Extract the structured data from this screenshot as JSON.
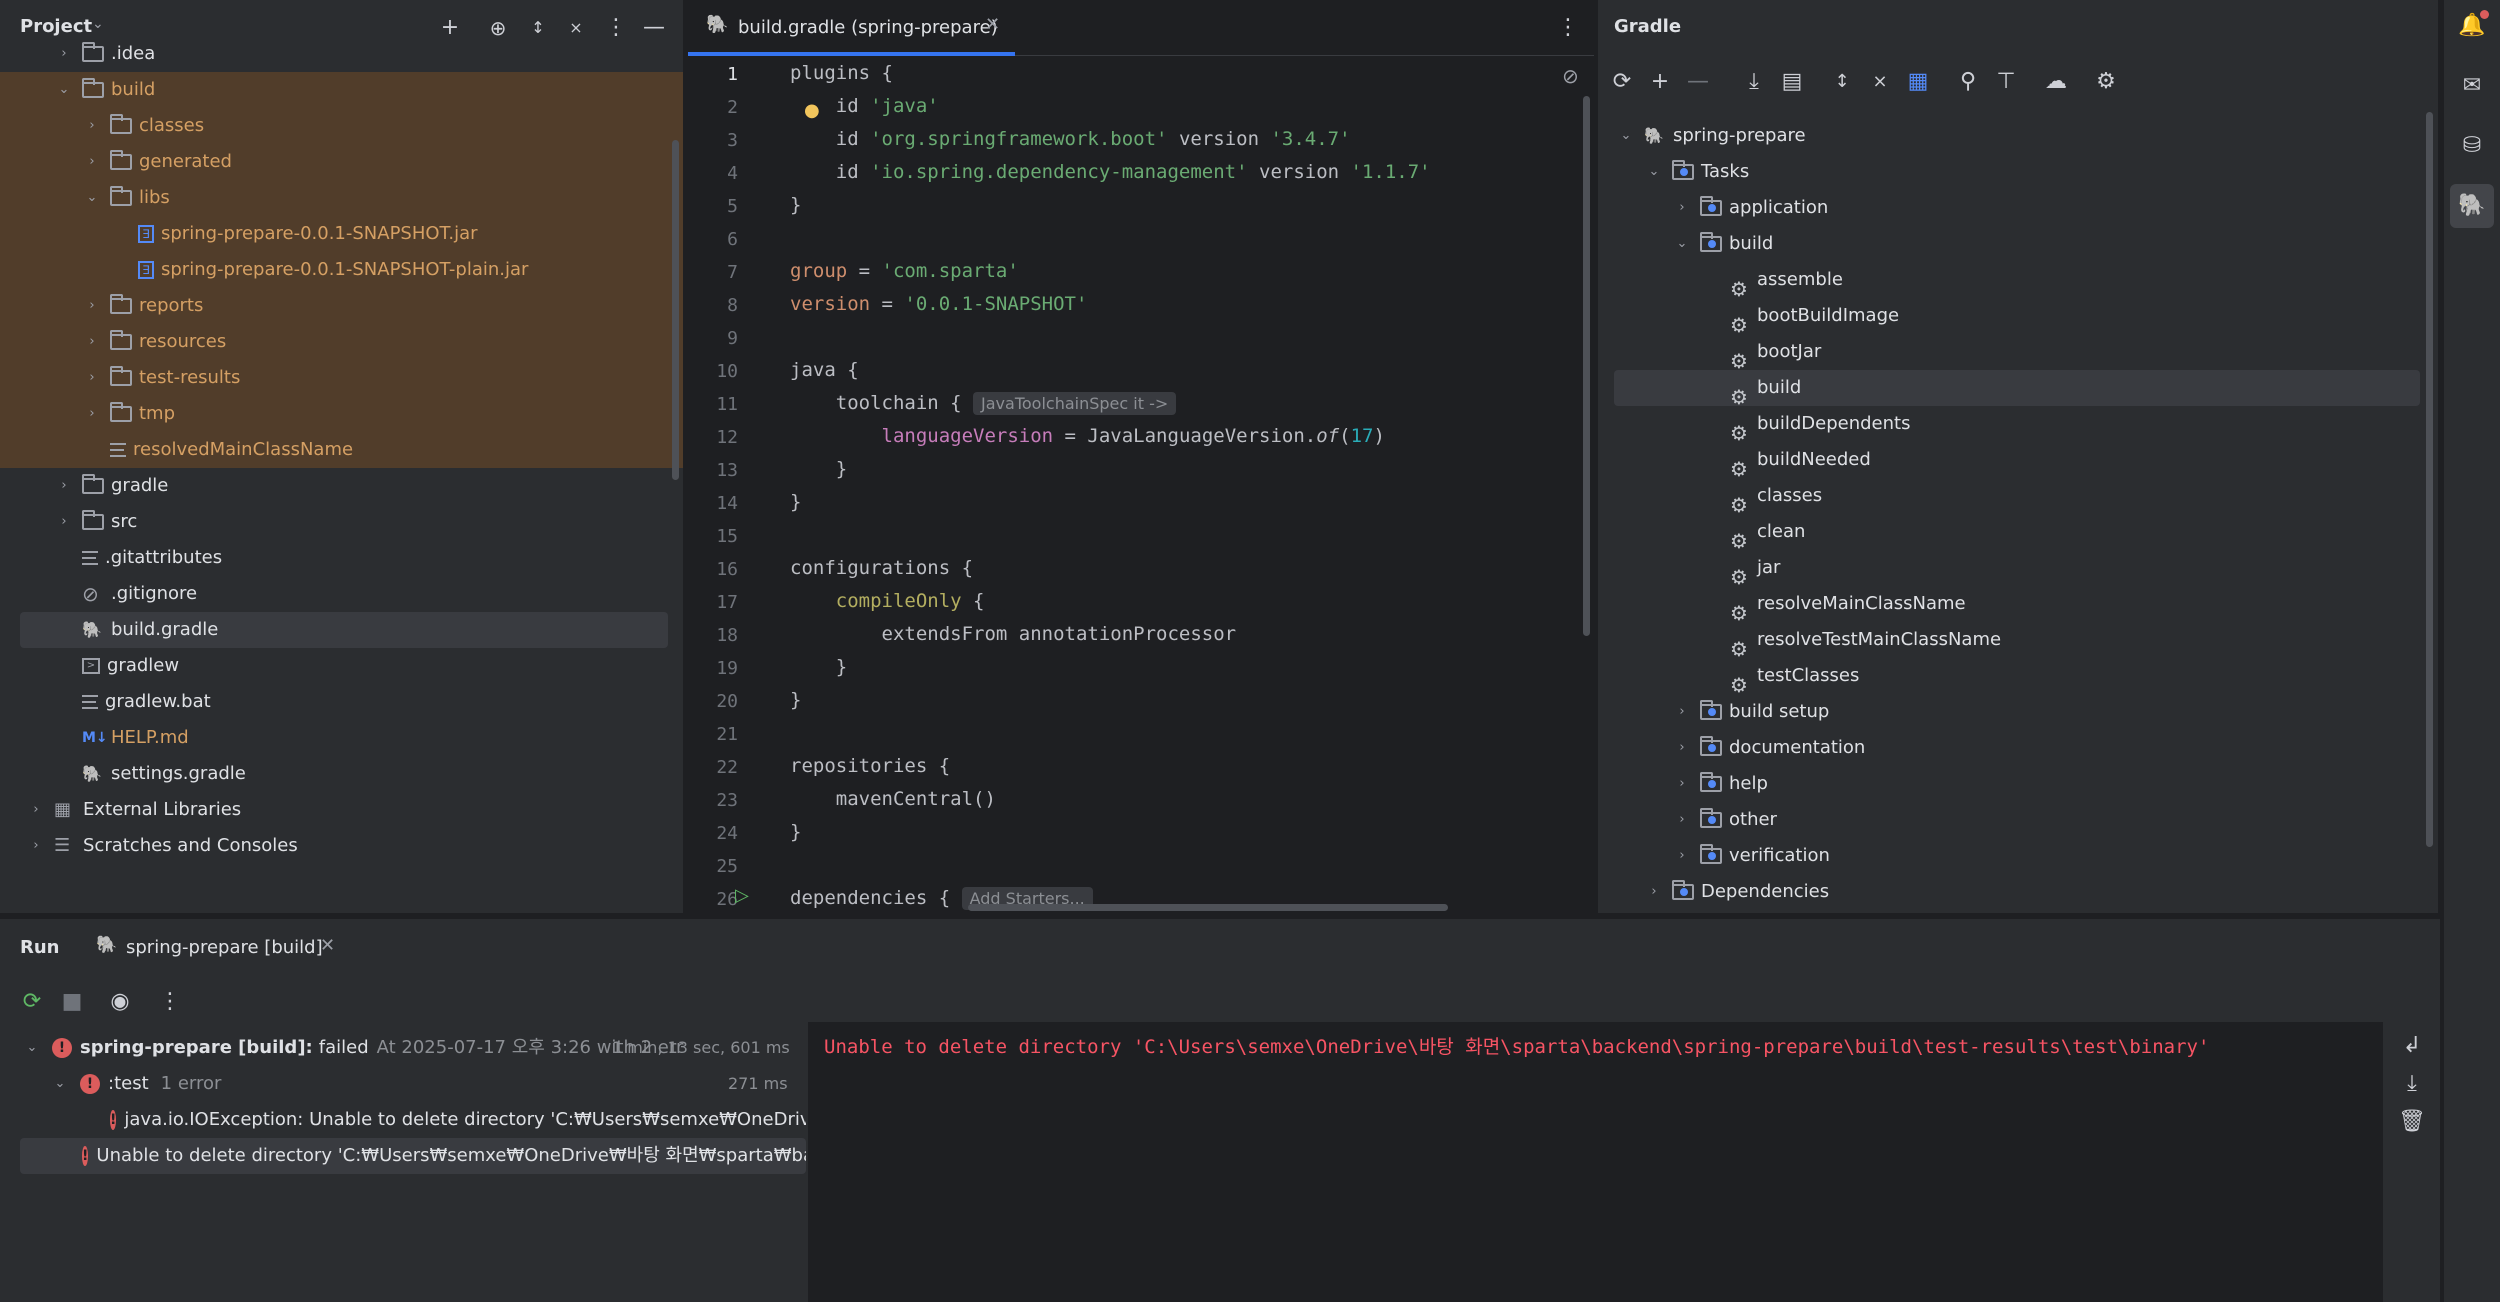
{
  "project": {
    "title": "Project",
    "tree": [
      {
        "label": ".idea",
        "type": "folder",
        "indent": 1,
        "chev": "right"
      },
      {
        "label": "build",
        "type": "folder",
        "indent": 1,
        "chev": "down",
        "excluded": true
      },
      {
        "label": "classes",
        "type": "folder",
        "indent": 2,
        "chev": "right",
        "excluded": true
      },
      {
        "label": "generated",
        "type": "folder",
        "indent": 2,
        "chev": "right",
        "excluded": true
      },
      {
        "label": "libs",
        "type": "folder",
        "indent": 2,
        "chev": "down",
        "excluded": true
      },
      {
        "label": "spring-prepare-0.0.1-SNAPSHOT.jar",
        "type": "jar",
        "indent": 3,
        "excluded": true
      },
      {
        "label": "spring-prepare-0.0.1-SNAPSHOT-plain.jar",
        "type": "jar",
        "indent": 3,
        "excluded": true
      },
      {
        "label": "reports",
        "type": "folder",
        "indent": 2,
        "chev": "right",
        "excluded": true
      },
      {
        "label": "resources",
        "type": "folder",
        "indent": 2,
        "chev": "right",
        "excluded": true
      },
      {
        "label": "test-results",
        "type": "folder",
        "indent": 2,
        "chev": "right",
        "excluded": true
      },
      {
        "label": "tmp",
        "type": "folder",
        "indent": 2,
        "chev": "right",
        "excluded": true
      },
      {
        "label": "resolvedMainClassName",
        "type": "text",
        "indent": 2,
        "excluded": true
      },
      {
        "label": "gradle",
        "type": "folder",
        "indent": 1,
        "chev": "right"
      },
      {
        "label": "src",
        "type": "folder",
        "indent": 1,
        "chev": "right"
      },
      {
        "label": ".gitattributes",
        "type": "text",
        "indent": 1
      },
      {
        "label": ".gitignore",
        "type": "ignore",
        "indent": 1
      },
      {
        "label": "build.gradle",
        "type": "gradle",
        "indent": 1,
        "selected": true
      },
      {
        "label": "gradlew",
        "type": "shell",
        "indent": 1
      },
      {
        "label": "gradlew.bat",
        "type": "text",
        "indent": 1
      },
      {
        "label": "HELP.md",
        "type": "md",
        "indent": 1
      },
      {
        "label": "settings.gradle",
        "type": "gradle",
        "indent": 1
      },
      {
        "label": "External Libraries",
        "type": "library",
        "indent": 0,
        "chev": "right"
      },
      {
        "label": "Scratches and Consoles",
        "type": "scratch",
        "indent": 0,
        "chev": "right"
      }
    ]
  },
  "editor": {
    "tab_label": "build.gradle (spring-prepare)",
    "lines": [
      "1",
      "2",
      "3",
      "4",
      "5",
      "6",
      "7",
      "8",
      "9",
      "10",
      "11",
      "12",
      "13",
      "14",
      "15",
      "16",
      "17",
      "18",
      "19",
      "20",
      "21",
      "22",
      "23",
      "24",
      "25",
      "26"
    ],
    "hint_toolchain": "JavaToolchainSpec it ->",
    "hint_starters": "Add Starters..."
  },
  "gradle": {
    "title": "Gradle",
    "tree": [
      {
        "label": "spring-prepare",
        "type": "project",
        "indent": 0,
        "chev": "down"
      },
      {
        "label": "Tasks",
        "type": "taskgroup",
        "indent": 1,
        "chev": "down"
      },
      {
        "label": "application",
        "type": "taskgroup",
        "indent": 2,
        "chev": "right"
      },
      {
        "label": "build",
        "type": "taskgroup",
        "indent": 2,
        "chev": "down"
      },
      {
        "label": "assemble",
        "type": "task",
        "indent": 3
      },
      {
        "label": "bootBuildImage",
        "type": "task",
        "indent": 3
      },
      {
        "label": "bootJar",
        "type": "task",
        "indent": 3
      },
      {
        "label": "build",
        "type": "task",
        "indent": 3,
        "selected": true
      },
      {
        "label": "buildDependents",
        "type": "task",
        "indent": 3
      },
      {
        "label": "buildNeeded",
        "type": "task",
        "indent": 3
      },
      {
        "label": "classes",
        "type": "task",
        "indent": 3
      },
      {
        "label": "clean",
        "type": "task",
        "indent": 3
      },
      {
        "label": "jar",
        "type": "task",
        "indent": 3
      },
      {
        "label": "resolveMainClassName",
        "type": "task",
        "indent": 3
      },
      {
        "label": "resolveTestMainClassName",
        "type": "task",
        "indent": 3
      },
      {
        "label": "testClasses",
        "type": "task",
        "indent": 3
      },
      {
        "label": "build setup",
        "type": "taskgroup",
        "indent": 2,
        "chev": "right"
      },
      {
        "label": "documentation",
        "type": "taskgroup",
        "indent": 2,
        "chev": "right"
      },
      {
        "label": "help",
        "type": "taskgroup",
        "indent": 2,
        "chev": "right"
      },
      {
        "label": "other",
        "type": "taskgroup",
        "indent": 2,
        "chev": "right"
      },
      {
        "label": "verification",
        "type": "taskgroup",
        "indent": 2,
        "chev": "right"
      },
      {
        "label": "Dependencies",
        "type": "taskgroup",
        "indent": 1,
        "chev": "right"
      }
    ]
  },
  "run": {
    "title": "Run",
    "tab_label": "spring-prepare [build]",
    "tree": {
      "root_name": "spring-prepare [build]:",
      "root_status": "failed",
      "root_detail": "At 2025-07-17 오후 3:26 with 2 err",
      "root_time": "1 min, 13 sec, 601 ms",
      "test_name": ":test",
      "test_detail": "1 error",
      "test_time": "271 ms",
      "exception": "java.io.IOException: Unable to delete directory 'C:₩Users₩semxe₩OneDrive₩바탕",
      "error": "Unable to delete directory 'C:₩Users₩semxe₩OneDrive₩바탕 화면₩sparta₩backend₩"
    },
    "console": "Unable to delete directory 'C:\\Users\\semxe\\OneDrive\\바탕 화면\\sparta\\backend\\spring-prepare\\build\\test-results\\test\\binary'"
  },
  "colors": {
    "accent": "#3574f0",
    "error": "#db5c5c",
    "excluded_fg": "#d5a064"
  }
}
